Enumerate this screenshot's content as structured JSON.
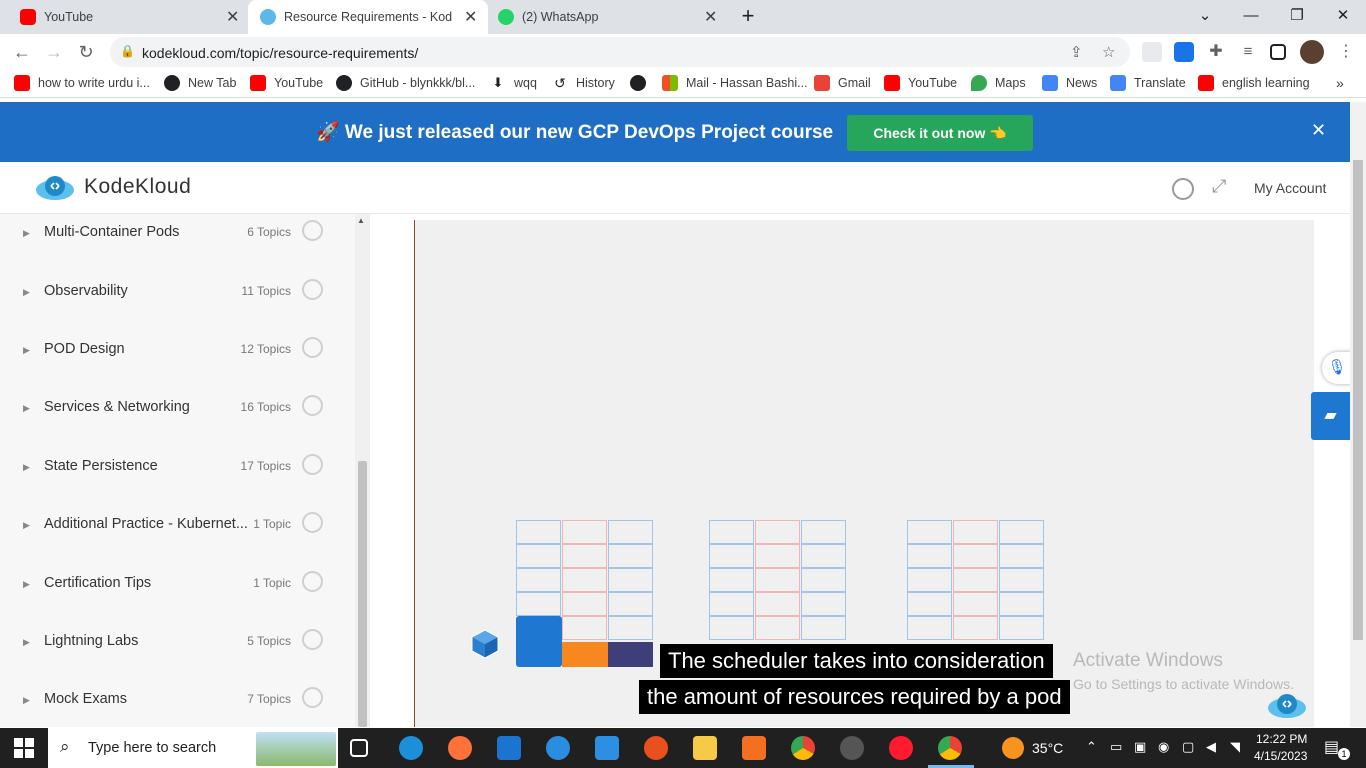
{
  "browser": {
    "tabs": [
      {
        "title": "YouTube",
        "active": false,
        "icon": "youtube-icon"
      },
      {
        "title": "Resource Requirements - KodeKl",
        "active": true,
        "icon": "kodekloud-icon"
      },
      {
        "title": "(2) WhatsApp",
        "active": false,
        "icon": "whatsapp-icon"
      }
    ],
    "new_tab": "+",
    "url": "kodekloud.com/topic/resource-requirements/"
  },
  "bookmarks": [
    {
      "label": "how to write urdu i...",
      "icon": "youtube-icon",
      "color": "#ff0000"
    },
    {
      "label": "New Tab",
      "icon": "globe-icon",
      "color": "#202124"
    },
    {
      "label": "YouTube",
      "icon": "youtube-icon",
      "color": "#ff0000"
    },
    {
      "label": "GitHub - blynkkk/bl...",
      "icon": "github-icon",
      "color": "#202124"
    },
    {
      "label": "wqq",
      "icon": "download-icon",
      "color": "#202124"
    },
    {
      "label": "History",
      "icon": "history-icon",
      "color": "#202124"
    },
    {
      "label": "",
      "icon": "globe-icon",
      "color": "#202124"
    },
    {
      "label": "Mail - Hassan Bashi...",
      "icon": "microsoft-icon",
      "color": "#f25022"
    },
    {
      "label": "Gmail",
      "icon": "gmail-icon",
      "color": "#ea4335"
    },
    {
      "label": "YouTube",
      "icon": "youtube-icon",
      "color": "#ff0000"
    },
    {
      "label": "Maps",
      "icon": "maps-icon",
      "color": "#34a853"
    },
    {
      "label": "News",
      "icon": "news-icon",
      "color": "#4285f4"
    },
    {
      "label": "Translate",
      "icon": "translate-icon",
      "color": "#4285f4"
    },
    {
      "label": "english learning",
      "icon": "youtube-icon",
      "color": "#ff0000"
    }
  ],
  "banner": {
    "message": "🚀 We just released our new GCP DevOps Project course",
    "cta": "Check it out now 👈",
    "close": "✕"
  },
  "header": {
    "brand": "KodeKloud",
    "account": "My Account"
  },
  "sidebar": {
    "items": [
      {
        "title": "Multi-Container Pods",
        "count": "6 Topics"
      },
      {
        "title": "Observability",
        "count": "11 Topics"
      },
      {
        "title": "POD Design",
        "count": "12 Topics"
      },
      {
        "title": "Services & Networking",
        "count": "16 Topics"
      },
      {
        "title": "State Persistence",
        "count": "17 Topics"
      },
      {
        "title": "Additional Practice - Kubernet...",
        "count": "1 Topic"
      },
      {
        "title": "Certification Tips",
        "count": "1 Topic"
      },
      {
        "title": "Lightning Labs",
        "count": "5 Topics"
      },
      {
        "title": "Mock Exams",
        "count": "7 Topics"
      }
    ]
  },
  "video": {
    "subtitle_line1": "The scheduler takes into consideration",
    "subtitle_line2": "the amount of resources required by a pod",
    "watermark_title": "Activate Windows",
    "watermark_sub": "Go to Settings to activate Windows.",
    "blocks": {
      "blue": "#1e78d2",
      "orange": "#f7871f",
      "navy": "#3e3e78"
    }
  },
  "taskbar": {
    "search_placeholder": "Type here to search",
    "temperature": "35°C",
    "time": "12:22 PM",
    "date": "4/15/2023",
    "notifications": "1"
  }
}
